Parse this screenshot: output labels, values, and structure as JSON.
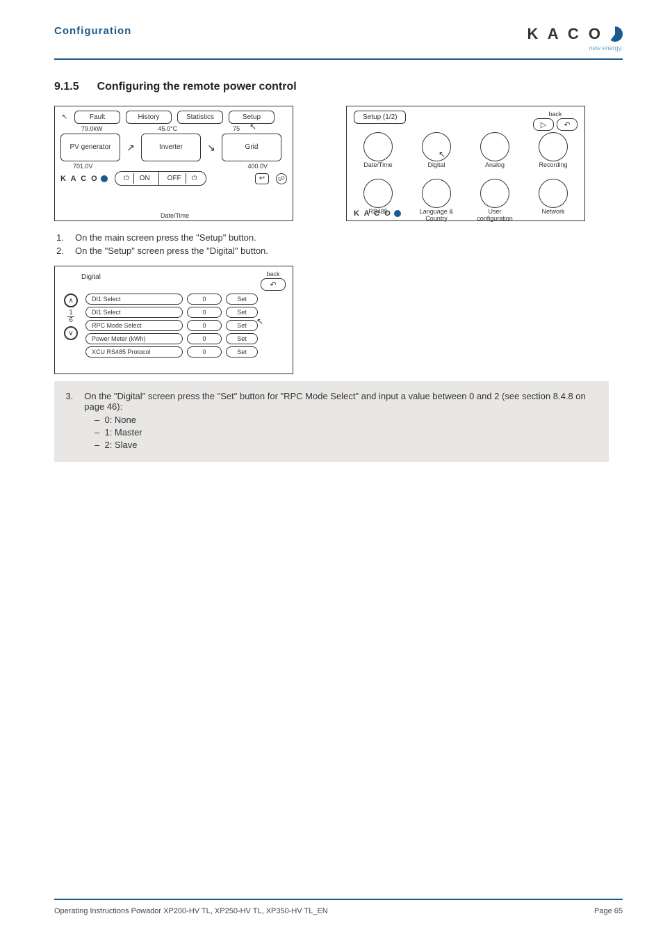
{
  "header": {
    "title": "Configuration"
  },
  "logo": {
    "brand": "K A C O",
    "tagline": "new energy."
  },
  "section": {
    "number": "9.1.5",
    "title": "Configuring the remote power control"
  },
  "screen1": {
    "top": {
      "fault": "Fault",
      "history": "History",
      "statistics": "Statistics",
      "setup": "Setup"
    },
    "vals": {
      "kw": "79.0kW",
      "tempC": "45.0°C",
      "eff": "75"
    },
    "mid": {
      "pv": "PV generator",
      "inverter": "Inverter",
      "grid": "Grid"
    },
    "vals2": {
      "vdc": "701.0V",
      "vac": "400.0V"
    },
    "bottom": {
      "brand": "K A C O",
      "on": "ON",
      "off": "OFF",
      "datetime": "Date/Time",
      "sd": "SD",
      "back": "↩"
    }
  },
  "screen2": {
    "title": "Setup (1/2)",
    "back": "back",
    "nav": {
      "next": "▷",
      "return": "↶"
    },
    "items": [
      "Date/Time",
      "Digital",
      "Analog",
      "Recording",
      "RS485",
      "Language & Country",
      "User configuration",
      "Network"
    ],
    "brand": "K A C O"
  },
  "steps12": [
    {
      "n": "1.",
      "text": "On the main screen press the \"Setup\" button."
    },
    {
      "n": "2.",
      "text": "On the \"Setup\" screen press the \"Digital\" button."
    }
  ],
  "screen3": {
    "title": "Digital",
    "back": "back",
    "return": "↶",
    "page": {
      "cur": "1",
      "total": "6"
    },
    "up": "∧",
    "down": "∨",
    "rows": [
      {
        "label": "DI1 Select",
        "val": "0",
        "set": "Set"
      },
      {
        "label": "DI1 Select",
        "val": "0",
        "set": "Set"
      },
      {
        "label": "RPC Mode Select",
        "val": "0",
        "set": "Set"
      },
      {
        "label": "Power Meter (kWh)",
        "val": "0",
        "set": "Set"
      },
      {
        "label": "XCU RS485 Protocol",
        "val": "0",
        "set": "Set"
      }
    ]
  },
  "step3": {
    "n": "3.",
    "text": "On the \"Digital\" screen press the \"Set\" button for \"RPC Mode Select\" and input a value between 0 and 2 (see section 8.4.8 on page 46):",
    "opts": [
      "0: None",
      "1: Master",
      "2: Slave"
    ],
    "dash": "–"
  },
  "footer": {
    "left": "Operating Instructions Powador XP200-HV TL, XP250-HV TL, XP350-HV TL_EN",
    "right": "Page 65"
  }
}
